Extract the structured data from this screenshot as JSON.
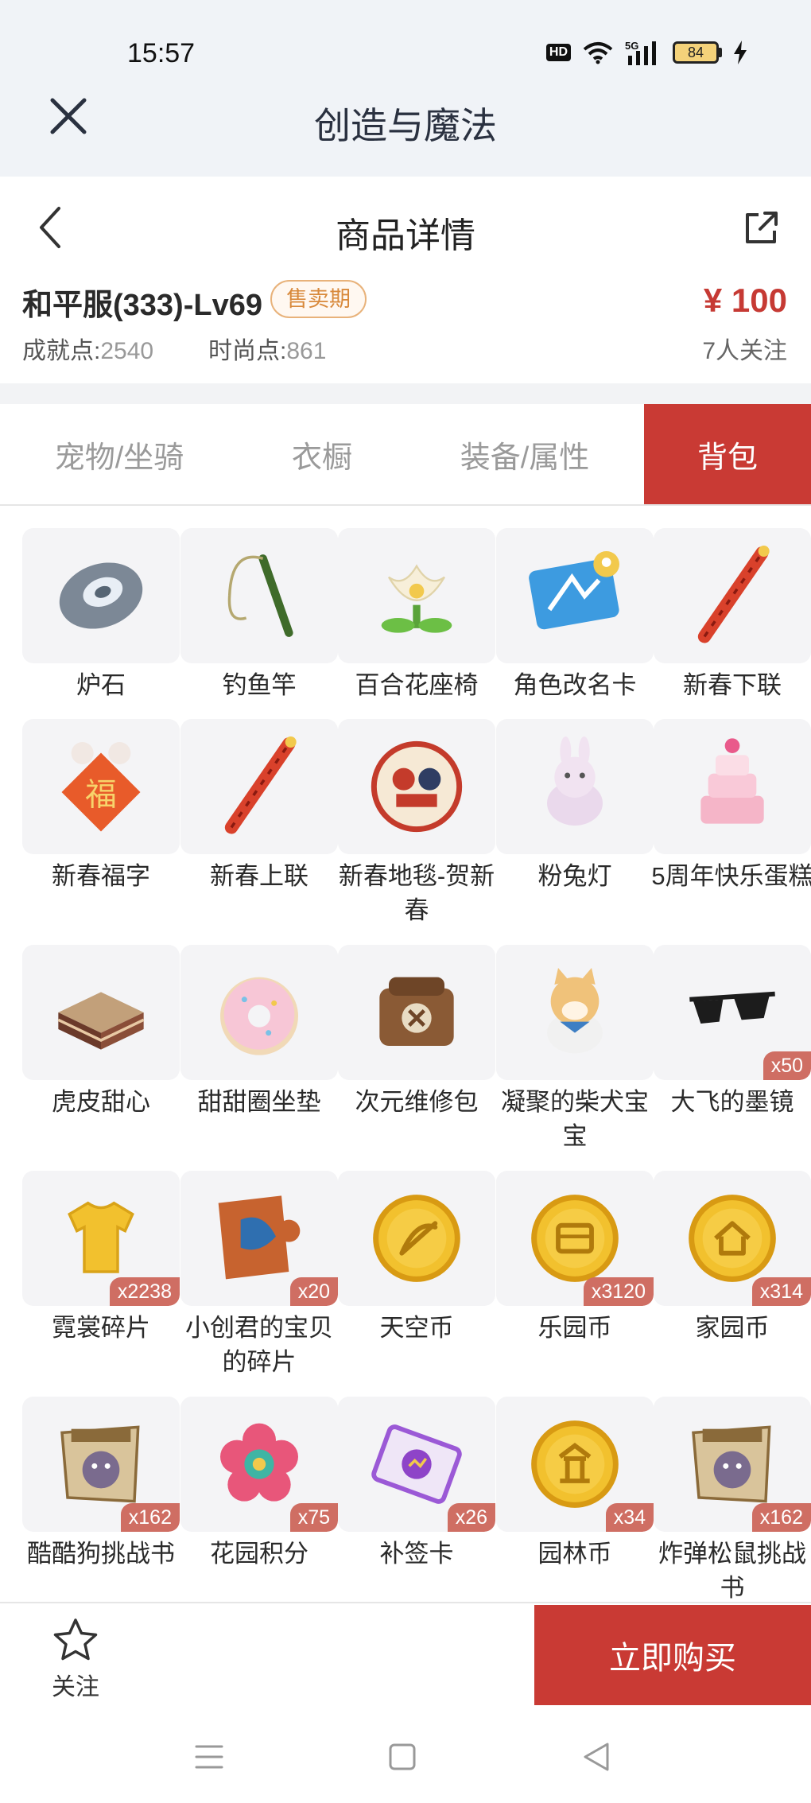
{
  "status_bar": {
    "time": "15:57",
    "hd": "HD",
    "network": "5G",
    "battery": "84"
  },
  "app": {
    "title": "创造与魔法"
  },
  "header": {
    "title": "商品详情"
  },
  "product": {
    "name": "和平服(333)-Lv69",
    "badge": "售卖期",
    "achievement_label": "成就点:",
    "achievement_value": "2540",
    "fashion_label": "时尚点:",
    "fashion_value": "861",
    "price": "¥ 100",
    "followers": "7人关注"
  },
  "tabs": [
    {
      "label": "宠物/坐骑",
      "active": false
    },
    {
      "label": "衣橱",
      "active": false
    },
    {
      "label": "装备/属性",
      "active": false
    },
    {
      "label": "背包",
      "active": true
    }
  ],
  "items": [
    {
      "name": "炉石",
      "icon": "stone-icon",
      "qty": ""
    },
    {
      "name": "钓鱼竿",
      "icon": "fishing-rod-icon",
      "qty": ""
    },
    {
      "name": "百合花座椅",
      "icon": "lily-chair-icon",
      "qty": ""
    },
    {
      "name": "角色改名卡",
      "icon": "rename-card-icon",
      "qty": ""
    },
    {
      "name": "新春下联",
      "icon": "couplet-icon",
      "qty": ""
    },
    {
      "name": "新春福字",
      "icon": "fu-character-icon",
      "qty": ""
    },
    {
      "name": "新春上联",
      "icon": "couplet-icon",
      "qty": ""
    },
    {
      "name": "新春地毯-贺新春",
      "icon": "new-year-carpet-icon",
      "qty": ""
    },
    {
      "name": "粉兔灯",
      "icon": "pink-rabbit-lamp-icon",
      "qty": ""
    },
    {
      "name": "5周年快乐蛋糕",
      "icon": "cake-icon",
      "qty": ""
    },
    {
      "name": "虎皮甜心",
      "icon": "layer-cake-icon",
      "qty": ""
    },
    {
      "name": "甜甜圈坐垫",
      "icon": "donut-cushion-icon",
      "qty": ""
    },
    {
      "name": "次元维修包",
      "icon": "repair-bag-icon",
      "qty": ""
    },
    {
      "name": "凝聚的柴犬宝宝",
      "icon": "shiba-plush-icon",
      "qty": ""
    },
    {
      "name": "大飞的墨镜",
      "icon": "sunglasses-icon",
      "qty": "x50"
    },
    {
      "name": "霓裳碎片",
      "icon": "shirt-fragment-icon",
      "qty": "x2238"
    },
    {
      "name": "小创君的宝贝的碎片",
      "icon": "puzzle-piece-icon",
      "qty": "x20"
    },
    {
      "name": "天空币",
      "icon": "sky-coin-icon",
      "qty": ""
    },
    {
      "name": "乐园币",
      "icon": "park-coin-icon",
      "qty": "x3120"
    },
    {
      "name": "家园币",
      "icon": "home-coin-icon",
      "qty": "x314"
    },
    {
      "name": "酷酷狗挑战书",
      "icon": "wanted-poster-icon",
      "qty": "x162"
    },
    {
      "name": "花园积分",
      "icon": "flower-badge-icon",
      "qty": "x75"
    },
    {
      "name": "补签卡",
      "icon": "sign-card-icon",
      "qty": "x26"
    },
    {
      "name": "园林币",
      "icon": "garden-coin-icon",
      "qty": "x34"
    },
    {
      "name": "炸弹松鼠挑战书",
      "icon": "wanted-poster-icon",
      "qty": "x162"
    }
  ],
  "bottom": {
    "follow_label": "关注",
    "buy_label": "立即购买"
  },
  "colors": {
    "accent": "#c93a34",
    "badge_text": "#d8893b",
    "qty_bg": "#cf6e63"
  }
}
